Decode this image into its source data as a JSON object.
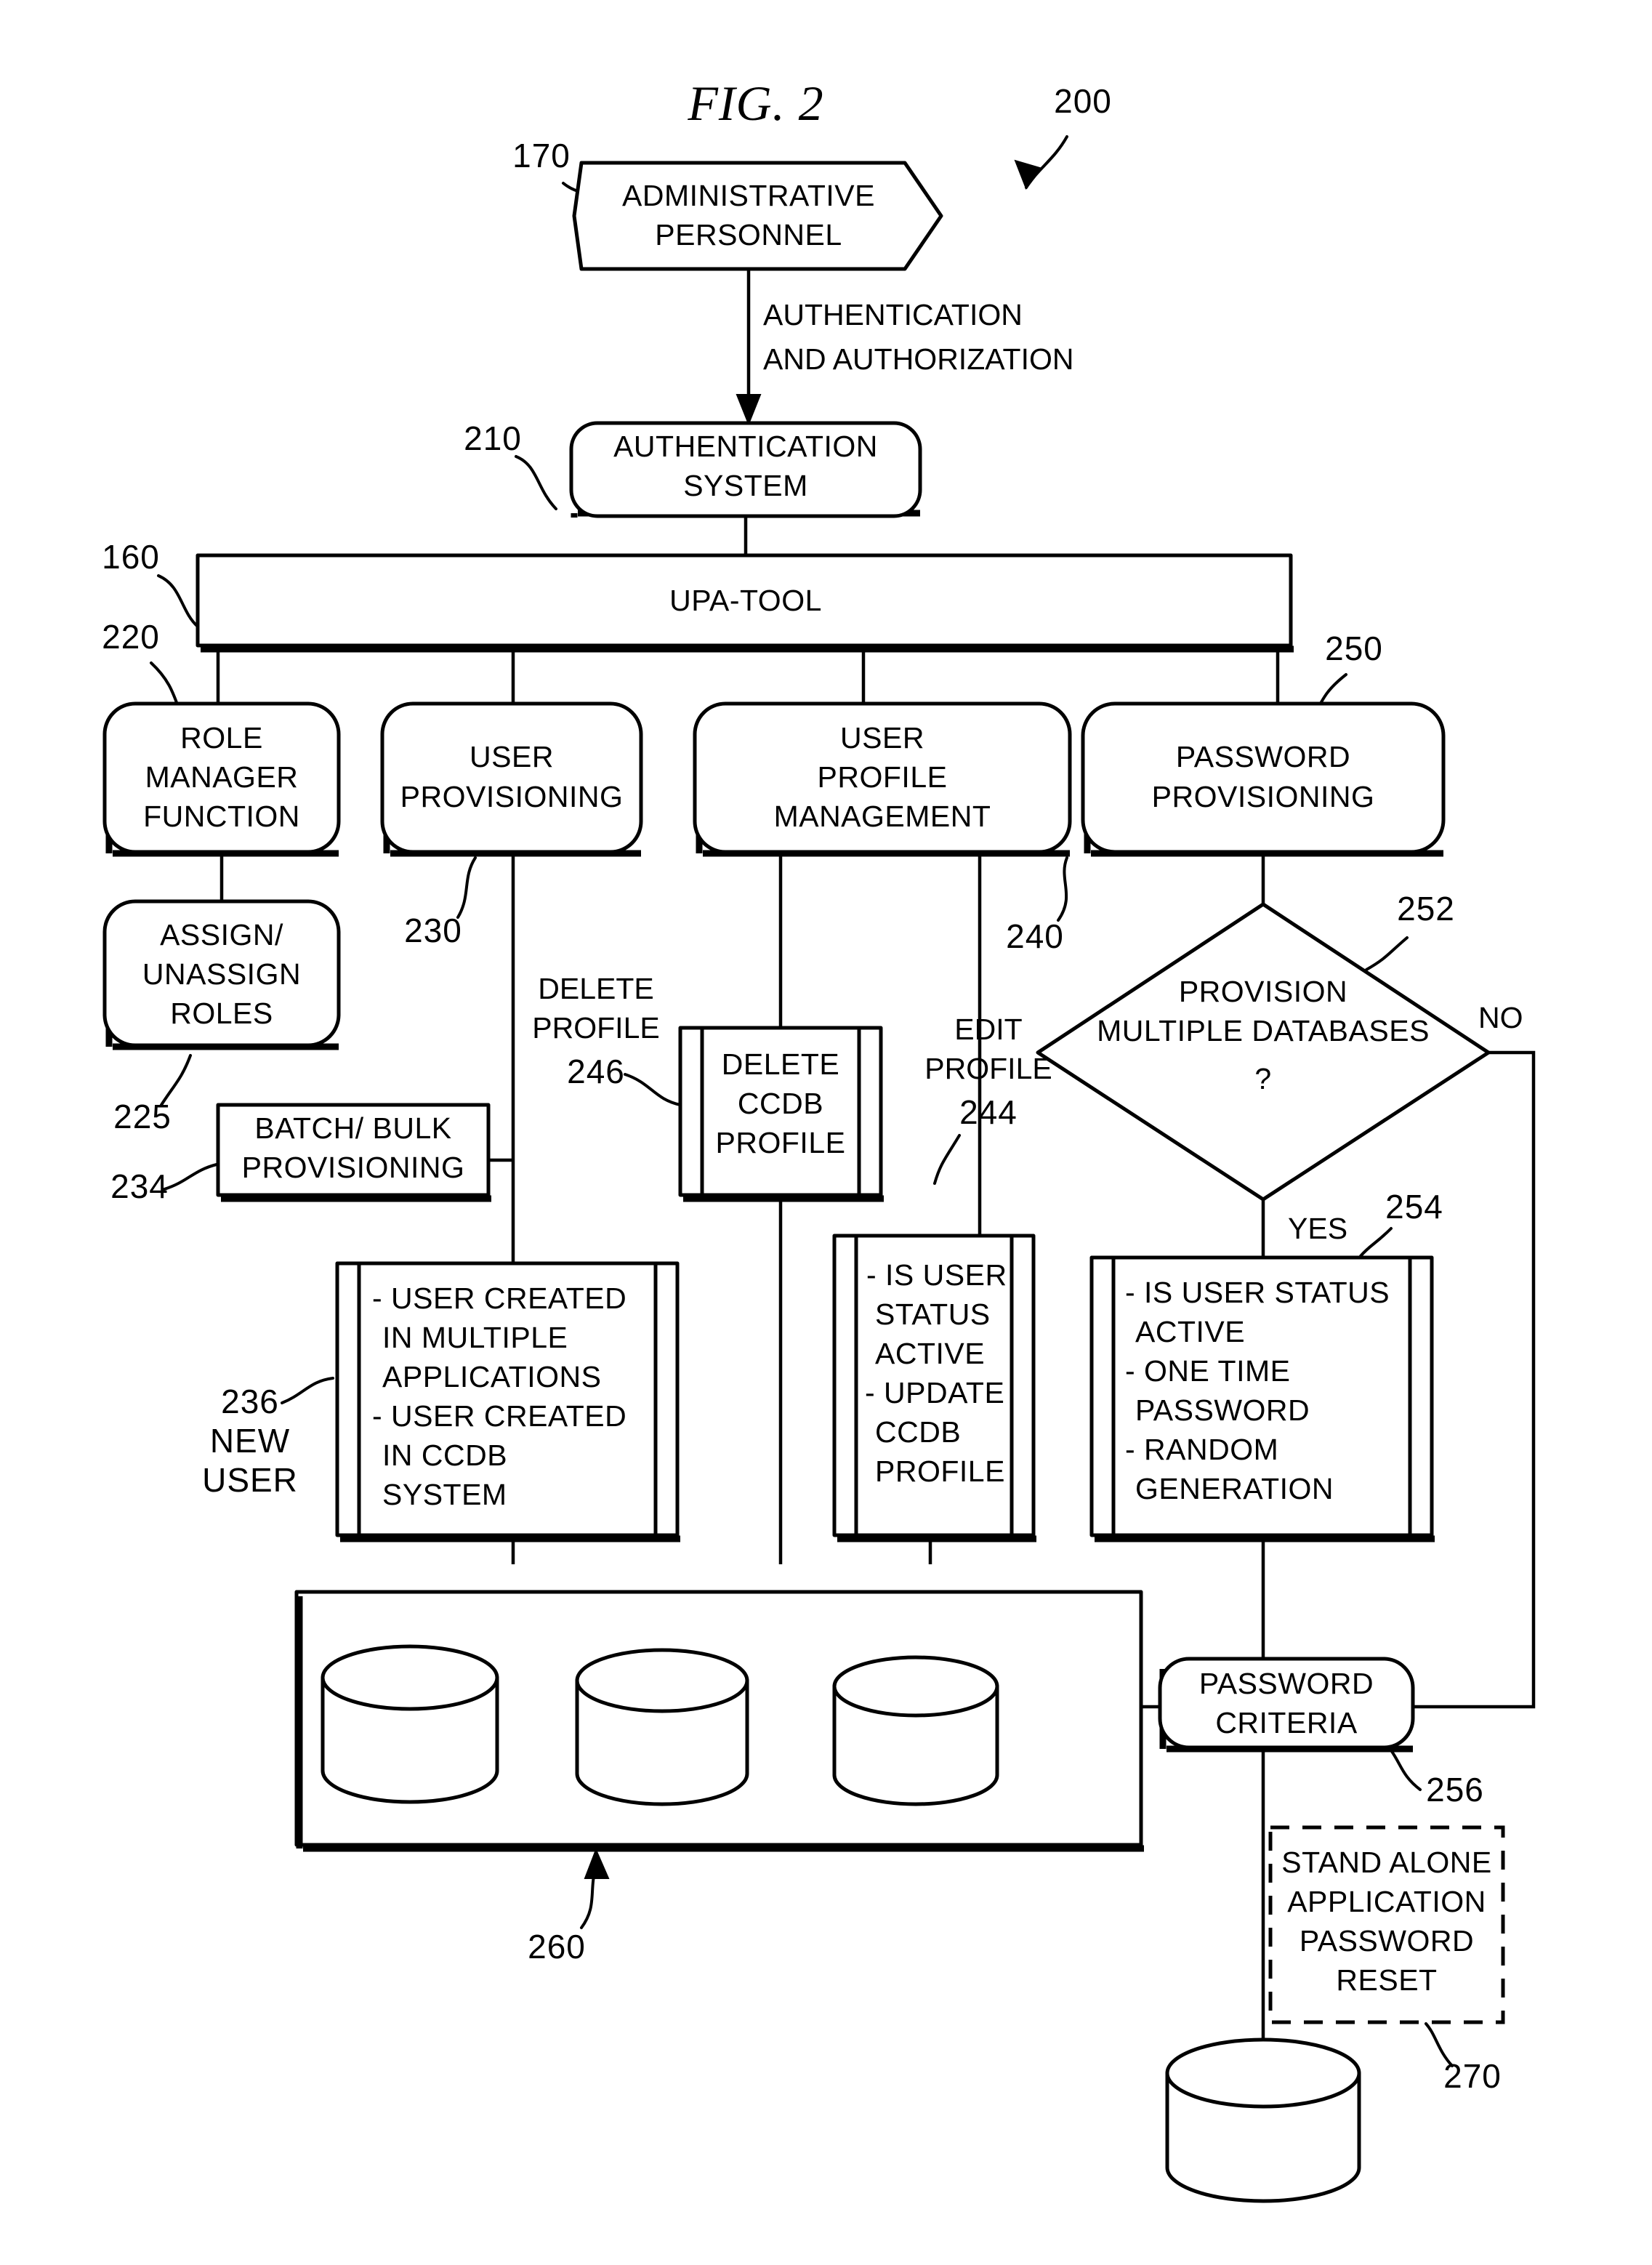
{
  "figure": {
    "title": "FIG. 2",
    "system_ref": "200"
  },
  "nodes": {
    "admin_personnel": {
      "ref": "170",
      "lines": [
        "ADMINISTRATIVE",
        "PERSONNEL"
      ],
      "shape": "hexagon"
    },
    "auth_system": {
      "ref": "210",
      "lines": [
        "AUTHENTICATION",
        "SYSTEM"
      ],
      "shape": "rounded-rect"
    },
    "upa_tool": {
      "ref": "160",
      "lines": [
        "UPA-TOOL"
      ],
      "shape": "rect"
    },
    "role_manager": {
      "ref": "220",
      "lines": [
        "ROLE",
        "MANAGER",
        "FUNCTION"
      ],
      "shape": "rounded-rect"
    },
    "assign_roles": {
      "ref": "225",
      "lines": [
        "ASSIGN/",
        "UNASSIGN",
        "ROLES"
      ],
      "shape": "rounded-rect"
    },
    "user_provisioning": {
      "ref": "230",
      "lines": [
        "USER",
        "PROVISIONING"
      ],
      "shape": "rounded-rect"
    },
    "batch_bulk": {
      "ref": "234",
      "lines": [
        "BATCH/ BULK",
        "PROVISIONING"
      ],
      "shape": "rect"
    },
    "new_user_process": {
      "ref": "236",
      "ref_sub": [
        "NEW",
        "USER"
      ],
      "lines": [
        "- USER CREATED",
        "IN MULTIPLE",
        "APPLICATIONS",
        "- USER CREATED",
        "IN CCDB",
        "SYSTEM"
      ],
      "shape": "process"
    },
    "user_profile_mgmt": {
      "ref": "240",
      "lines": [
        "USER",
        "PROFILE",
        "MANAGEMENT"
      ],
      "shape": "rounded-rect"
    },
    "delete_ccdb_profile": {
      "ref": "246",
      "lines": [
        "DELETE",
        "CCDB",
        "PROFILE"
      ],
      "shape": "process"
    },
    "edit_profile_process": {
      "ref": "244",
      "lines": [
        "- IS USER",
        "STATUS",
        "ACTIVE",
        "- UPDATE",
        "CCDB",
        "PROFILE"
      ],
      "shape": "process"
    },
    "password_provisioning": {
      "ref": "250",
      "lines": [
        "PASSWORD",
        "PROVISIONING"
      ],
      "shape": "rounded-rect"
    },
    "provision_decision": {
      "ref": "252",
      "lines": [
        "PROVISION",
        "MULTIPLE DATABASES",
        "?"
      ],
      "shape": "diamond"
    },
    "password_process": {
      "ref": "254",
      "lines": [
        "- IS USER STATUS",
        "ACTIVE",
        "- ONE TIME",
        "PASSWORD",
        "- RANDOM",
        "GENERATION"
      ],
      "shape": "process"
    },
    "password_criteria": {
      "ref": "256",
      "lines": [
        "PASSWORD",
        "CRITERIA"
      ],
      "shape": "rounded-rect"
    },
    "database_group": {
      "ref": "260",
      "shape": "rect-with-cylinders",
      "cylinder_count": 3
    },
    "standalone_reset": {
      "ref": "270",
      "lines": [
        "STAND ALONE",
        "APPLICATION",
        "PASSWORD",
        "RESET"
      ],
      "shape": "dashed-rect"
    },
    "standalone_db": {
      "shape": "cylinder"
    }
  },
  "edges": {
    "auth_label": [
      "AUTHENTICATION",
      "AND AUTHORIZATION"
    ],
    "delete_profile_label": [
      "DELETE",
      "PROFILE"
    ],
    "edit_profile_label": [
      "EDIT",
      "PROFILE"
    ],
    "decision_yes": "YES",
    "decision_no": "NO"
  },
  "colors": {
    "ink": "#000000",
    "paper": "#ffffff"
  }
}
